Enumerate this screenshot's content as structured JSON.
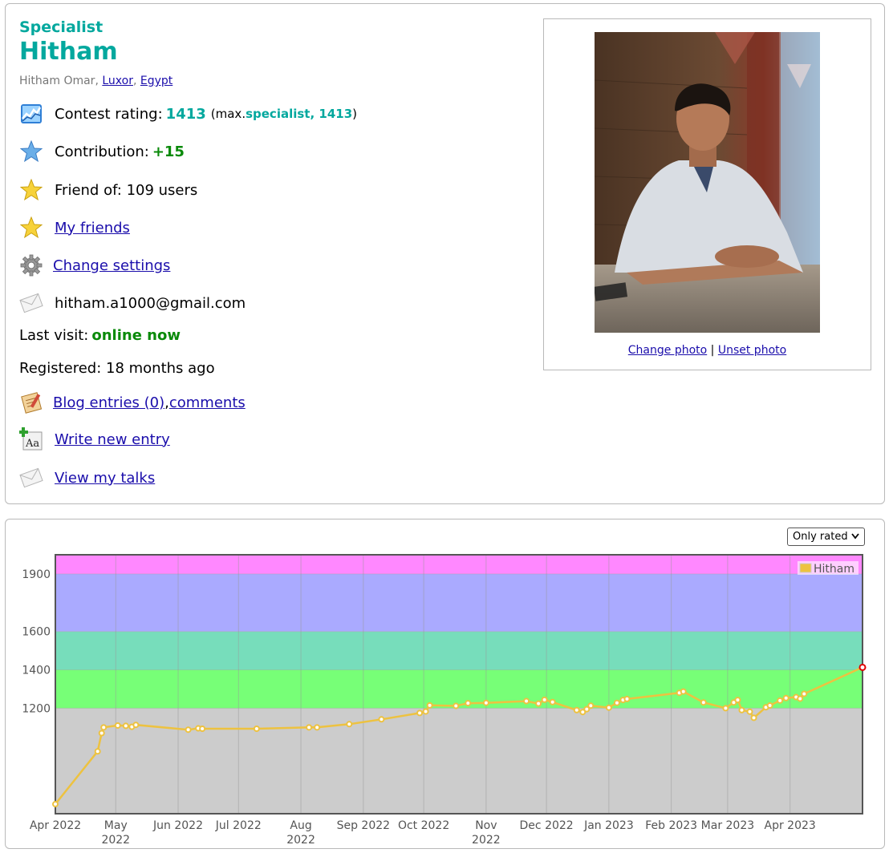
{
  "profile": {
    "rank": "Specialist",
    "handle": "Hitham",
    "name_prefix": "Hitham Omar, ",
    "city": "Luxor",
    "comma": ", ",
    "country": "Egypt",
    "rating_label": "Contest rating: ",
    "rating": "1413",
    "max_open": " (max. ",
    "max_rank_value": "specialist, 1413",
    "max_close": ")",
    "contribution_label": "Contribution: ",
    "contribution": "+15",
    "friend_of": "Friend of: 109 users",
    "my_friends": "My friends",
    "change_settings": "Change settings",
    "email": "hitham.a1000@gmail.com",
    "last_visit_label": "Last visit: ",
    "last_visit": "online now",
    "registered": "Registered: 18 months ago",
    "blog_entries": "Blog entries (0)",
    "blog_comma": ", ",
    "comments": "comments",
    "write_entry": "Write new entry",
    "view_talks": "View my talks",
    "change_photo": "Change photo",
    "photo_sep": " | ",
    "unset_photo": "Unset photo"
  },
  "filter": {
    "selected": "Only rated"
  },
  "icons": {
    "rating": "rating-graph-icon",
    "contribution": "blue-star-icon",
    "friend_of": "gold-star-icon",
    "my_friends": "gold-star-icon",
    "settings": "gear-icon",
    "email": "envelope-icon",
    "blog": "blog-notepad-icon",
    "write": "write-entry-icon",
    "talks": "envelope-icon"
  },
  "chart_data": {
    "type": "line",
    "series": [
      {
        "name": "Hitham",
        "color": "#edc240",
        "points": [
          [
            "2022-04-01",
            700
          ],
          [
            "2022-04-22",
            975
          ],
          [
            "2022-04-24",
            1070
          ],
          [
            "2022-04-25",
            1100
          ],
          [
            "2022-05-02",
            1110
          ],
          [
            "2022-05-06",
            1108
          ],
          [
            "2022-05-09",
            1103
          ],
          [
            "2022-05-11",
            1113
          ],
          [
            "2022-06-06",
            1088
          ],
          [
            "2022-06-11",
            1095
          ],
          [
            "2022-06-13",
            1093
          ],
          [
            "2022-07-10",
            1093
          ],
          [
            "2022-08-05",
            1100
          ],
          [
            "2022-08-09",
            1100
          ],
          [
            "2022-08-25",
            1117
          ],
          [
            "2022-09-10",
            1142
          ],
          [
            "2022-09-29",
            1175
          ],
          [
            "2022-10-02",
            1183
          ],
          [
            "2022-10-04",
            1215
          ],
          [
            "2022-10-17",
            1212
          ],
          [
            "2022-10-23",
            1226
          ],
          [
            "2022-11-01",
            1228
          ],
          [
            "2022-11-21",
            1237
          ],
          [
            "2022-11-27",
            1224
          ],
          [
            "2022-11-30",
            1244
          ],
          [
            "2022-12-04",
            1232
          ],
          [
            "2022-12-16",
            1190
          ],
          [
            "2022-12-19",
            1180
          ],
          [
            "2022-12-21",
            1195
          ],
          [
            "2022-12-23",
            1213
          ],
          [
            "2023-01-01",
            1203
          ],
          [
            "2023-01-05",
            1228
          ],
          [
            "2023-01-08",
            1243
          ],
          [
            "2023-01-10",
            1248
          ],
          [
            "2023-02-05",
            1280
          ],
          [
            "2023-02-07",
            1287
          ],
          [
            "2023-02-17",
            1230
          ],
          [
            "2023-02-28",
            1200
          ],
          [
            "2023-03-04",
            1230
          ],
          [
            "2023-03-06",
            1243
          ],
          [
            "2023-03-08",
            1190
          ],
          [
            "2023-03-12",
            1182
          ],
          [
            "2023-03-14",
            1150
          ],
          [
            "2023-03-20",
            1205
          ],
          [
            "2023-03-22",
            1214
          ],
          [
            "2023-03-27",
            1240
          ],
          [
            "2023-03-30",
            1253
          ],
          [
            "2023-04-04",
            1258
          ],
          [
            "2023-04-06",
            1250
          ],
          [
            "2023-04-08",
            1275
          ],
          [
            "2023-05-07",
            1413
          ]
        ]
      }
    ],
    "x_range": [
      "2022-04-01",
      "2023-05-07"
    ],
    "y_range": [
      650,
      2000
    ],
    "y_ticks": [
      1200,
      1400,
      1600,
      1900
    ],
    "x_ticks": [
      {
        "date": "2022-04-01",
        "label": "Apr 2022"
      },
      {
        "date": "2022-05-01",
        "label": "May",
        "sub": "2022"
      },
      {
        "date": "2022-06-01",
        "label": "Jun 2022"
      },
      {
        "date": "2022-07-01",
        "label": "Jul 2022"
      },
      {
        "date": "2022-08-01",
        "label": "Aug",
        "sub": "2022"
      },
      {
        "date": "2022-09-01",
        "label": "Sep 2022"
      },
      {
        "date": "2022-10-01",
        "label": "Oct 2022"
      },
      {
        "date": "2022-11-01",
        "label": "Nov",
        "sub": "2022"
      },
      {
        "date": "2022-12-01",
        "label": "Dec 2022"
      },
      {
        "date": "2023-01-01",
        "label": "Jan 2023"
      },
      {
        "date": "2023-02-01",
        "label": "Feb 2023"
      },
      {
        "date": "2023-03-01",
        "label": "Mar 2023"
      },
      {
        "date": "2023-04-01",
        "label": "Apr 2023"
      }
    ],
    "bands": [
      {
        "from": 650,
        "to": 1200,
        "color": "#cccccc"
      },
      {
        "from": 1200,
        "to": 1400,
        "color": "#77ff77"
      },
      {
        "from": 1400,
        "to": 1600,
        "color": "#77ddbb"
      },
      {
        "from": 1600,
        "to": 1900,
        "color": "#aaaaff"
      },
      {
        "from": 1900,
        "to": 2000,
        "color": "#ff88ff"
      }
    ],
    "legend_position": "top-right",
    "last_point_color": "#e00000",
    "grid": true
  }
}
